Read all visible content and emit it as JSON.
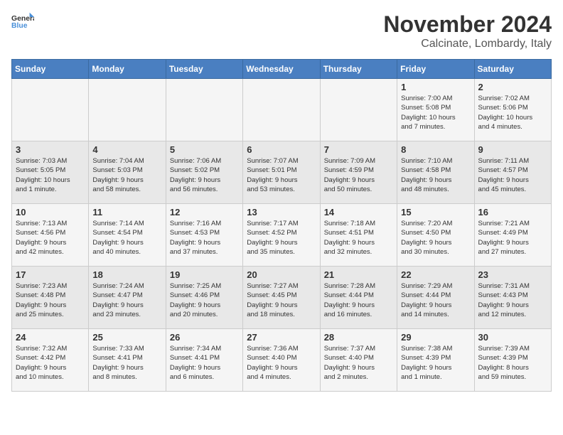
{
  "logo": {
    "text_general": "General",
    "text_blue": "Blue"
  },
  "title": "November 2024",
  "subtitle": "Calcinate, Lombardy, Italy",
  "weekdays": [
    "Sunday",
    "Monday",
    "Tuesday",
    "Wednesday",
    "Thursday",
    "Friday",
    "Saturday"
  ],
  "weeks": [
    [
      {
        "day": "",
        "info": ""
      },
      {
        "day": "",
        "info": ""
      },
      {
        "day": "",
        "info": ""
      },
      {
        "day": "",
        "info": ""
      },
      {
        "day": "",
        "info": ""
      },
      {
        "day": "1",
        "info": "Sunrise: 7:00 AM\nSunset: 5:08 PM\nDaylight: 10 hours\nand 7 minutes."
      },
      {
        "day": "2",
        "info": "Sunrise: 7:02 AM\nSunset: 5:06 PM\nDaylight: 10 hours\nand 4 minutes."
      }
    ],
    [
      {
        "day": "3",
        "info": "Sunrise: 7:03 AM\nSunset: 5:05 PM\nDaylight: 10 hours\nand 1 minute."
      },
      {
        "day": "4",
        "info": "Sunrise: 7:04 AM\nSunset: 5:03 PM\nDaylight: 9 hours\nand 58 minutes."
      },
      {
        "day": "5",
        "info": "Sunrise: 7:06 AM\nSunset: 5:02 PM\nDaylight: 9 hours\nand 56 minutes."
      },
      {
        "day": "6",
        "info": "Sunrise: 7:07 AM\nSunset: 5:01 PM\nDaylight: 9 hours\nand 53 minutes."
      },
      {
        "day": "7",
        "info": "Sunrise: 7:09 AM\nSunset: 4:59 PM\nDaylight: 9 hours\nand 50 minutes."
      },
      {
        "day": "8",
        "info": "Sunrise: 7:10 AM\nSunset: 4:58 PM\nDaylight: 9 hours\nand 48 minutes."
      },
      {
        "day": "9",
        "info": "Sunrise: 7:11 AM\nSunset: 4:57 PM\nDaylight: 9 hours\nand 45 minutes."
      }
    ],
    [
      {
        "day": "10",
        "info": "Sunrise: 7:13 AM\nSunset: 4:56 PM\nDaylight: 9 hours\nand 42 minutes."
      },
      {
        "day": "11",
        "info": "Sunrise: 7:14 AM\nSunset: 4:54 PM\nDaylight: 9 hours\nand 40 minutes."
      },
      {
        "day": "12",
        "info": "Sunrise: 7:16 AM\nSunset: 4:53 PM\nDaylight: 9 hours\nand 37 minutes."
      },
      {
        "day": "13",
        "info": "Sunrise: 7:17 AM\nSunset: 4:52 PM\nDaylight: 9 hours\nand 35 minutes."
      },
      {
        "day": "14",
        "info": "Sunrise: 7:18 AM\nSunset: 4:51 PM\nDaylight: 9 hours\nand 32 minutes."
      },
      {
        "day": "15",
        "info": "Sunrise: 7:20 AM\nSunset: 4:50 PM\nDaylight: 9 hours\nand 30 minutes."
      },
      {
        "day": "16",
        "info": "Sunrise: 7:21 AM\nSunset: 4:49 PM\nDaylight: 9 hours\nand 27 minutes."
      }
    ],
    [
      {
        "day": "17",
        "info": "Sunrise: 7:23 AM\nSunset: 4:48 PM\nDaylight: 9 hours\nand 25 minutes."
      },
      {
        "day": "18",
        "info": "Sunrise: 7:24 AM\nSunset: 4:47 PM\nDaylight: 9 hours\nand 23 minutes."
      },
      {
        "day": "19",
        "info": "Sunrise: 7:25 AM\nSunset: 4:46 PM\nDaylight: 9 hours\nand 20 minutes."
      },
      {
        "day": "20",
        "info": "Sunrise: 7:27 AM\nSunset: 4:45 PM\nDaylight: 9 hours\nand 18 minutes."
      },
      {
        "day": "21",
        "info": "Sunrise: 7:28 AM\nSunset: 4:44 PM\nDaylight: 9 hours\nand 16 minutes."
      },
      {
        "day": "22",
        "info": "Sunrise: 7:29 AM\nSunset: 4:44 PM\nDaylight: 9 hours\nand 14 minutes."
      },
      {
        "day": "23",
        "info": "Sunrise: 7:31 AM\nSunset: 4:43 PM\nDaylight: 9 hours\nand 12 minutes."
      }
    ],
    [
      {
        "day": "24",
        "info": "Sunrise: 7:32 AM\nSunset: 4:42 PM\nDaylight: 9 hours\nand 10 minutes."
      },
      {
        "day": "25",
        "info": "Sunrise: 7:33 AM\nSunset: 4:41 PM\nDaylight: 9 hours\nand 8 minutes."
      },
      {
        "day": "26",
        "info": "Sunrise: 7:34 AM\nSunset: 4:41 PM\nDaylight: 9 hours\nand 6 minutes."
      },
      {
        "day": "27",
        "info": "Sunrise: 7:36 AM\nSunset: 4:40 PM\nDaylight: 9 hours\nand 4 minutes."
      },
      {
        "day": "28",
        "info": "Sunrise: 7:37 AM\nSunset: 4:40 PM\nDaylight: 9 hours\nand 2 minutes."
      },
      {
        "day": "29",
        "info": "Sunrise: 7:38 AM\nSunset: 4:39 PM\nDaylight: 9 hours\nand 1 minute."
      },
      {
        "day": "30",
        "info": "Sunrise: 7:39 AM\nSunset: 4:39 PM\nDaylight: 8 hours\nand 59 minutes."
      }
    ]
  ]
}
